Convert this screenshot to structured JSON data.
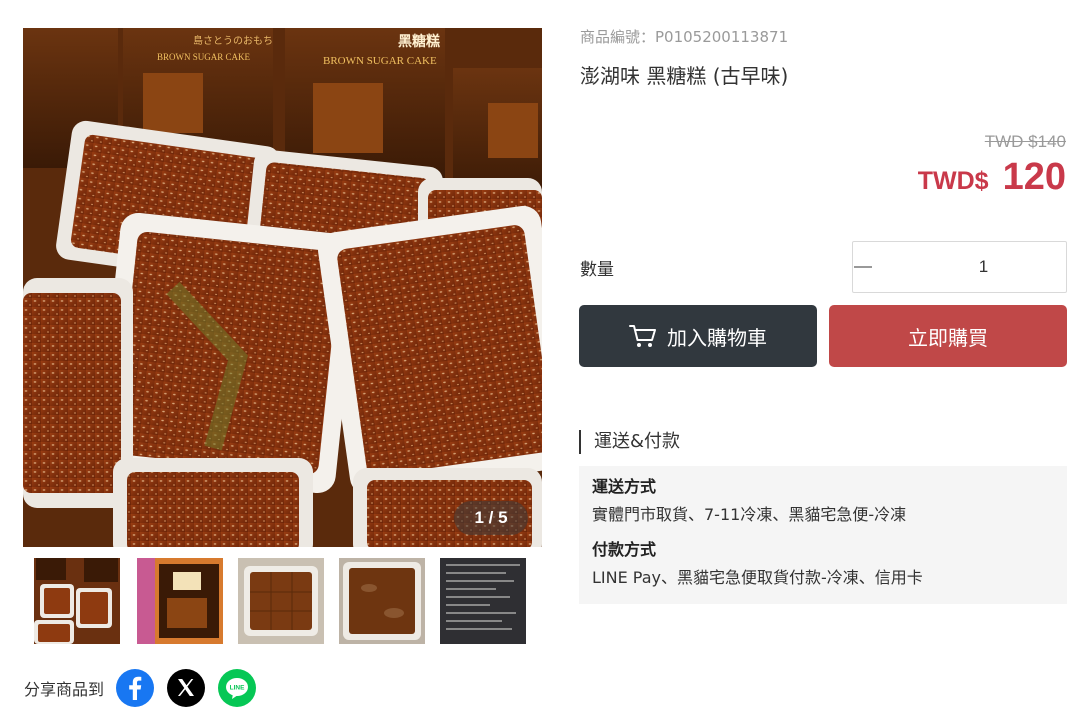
{
  "product": {
    "sku_label": "商品編號：P0105200113871",
    "title": "澎湖味 黑糖糕 (古早味)"
  },
  "gallery": {
    "counter": "1 / 5",
    "main_image": "brown-sugar-cake-packages-photo",
    "box_label_cn": "黑糖糕",
    "box_label_en": "BROWN SUGAR CAKE",
    "box_label_jp": "島さとうのおもち",
    "thumbnails": [
      {
        "name": "cake-trays-photo"
      },
      {
        "name": "cake-gift-box-photo"
      },
      {
        "name": "cake-tray-closeup-photo"
      },
      {
        "name": "cake-tray-top-photo"
      },
      {
        "name": "nutrition-label-photo"
      }
    ]
  },
  "pricing": {
    "original": "TWD $140",
    "currency": "TWD$",
    "amount": "120"
  },
  "quantity": {
    "label": "數量",
    "value": "1",
    "minus_icon": "minus-icon",
    "plus_icon": "plus-icon"
  },
  "actions": {
    "add_to_cart": "加入購物車",
    "buy_now": "立即購買",
    "cart_icon": "cart-icon"
  },
  "shipping": {
    "section_title": "運送&付款",
    "delivery_heading": "運送方式",
    "delivery_text": "實體門市取貨、7-11冷凍、黑貓宅急便-冷凍",
    "payment_heading": "付款方式",
    "payment_text": "LINE Pay、黑貓宅急便取貨付款-冷凍、信用卡"
  },
  "share": {
    "label": "分享商品到",
    "line_text": "LINE",
    "networks": [
      "facebook-icon",
      "x-icon",
      "line-icon"
    ]
  },
  "colors": {
    "price_red": "#c9394a",
    "cart_button": "#31383e",
    "buy_button": "#c04848",
    "facebook": "#1877f2",
    "line": "#06c755"
  }
}
